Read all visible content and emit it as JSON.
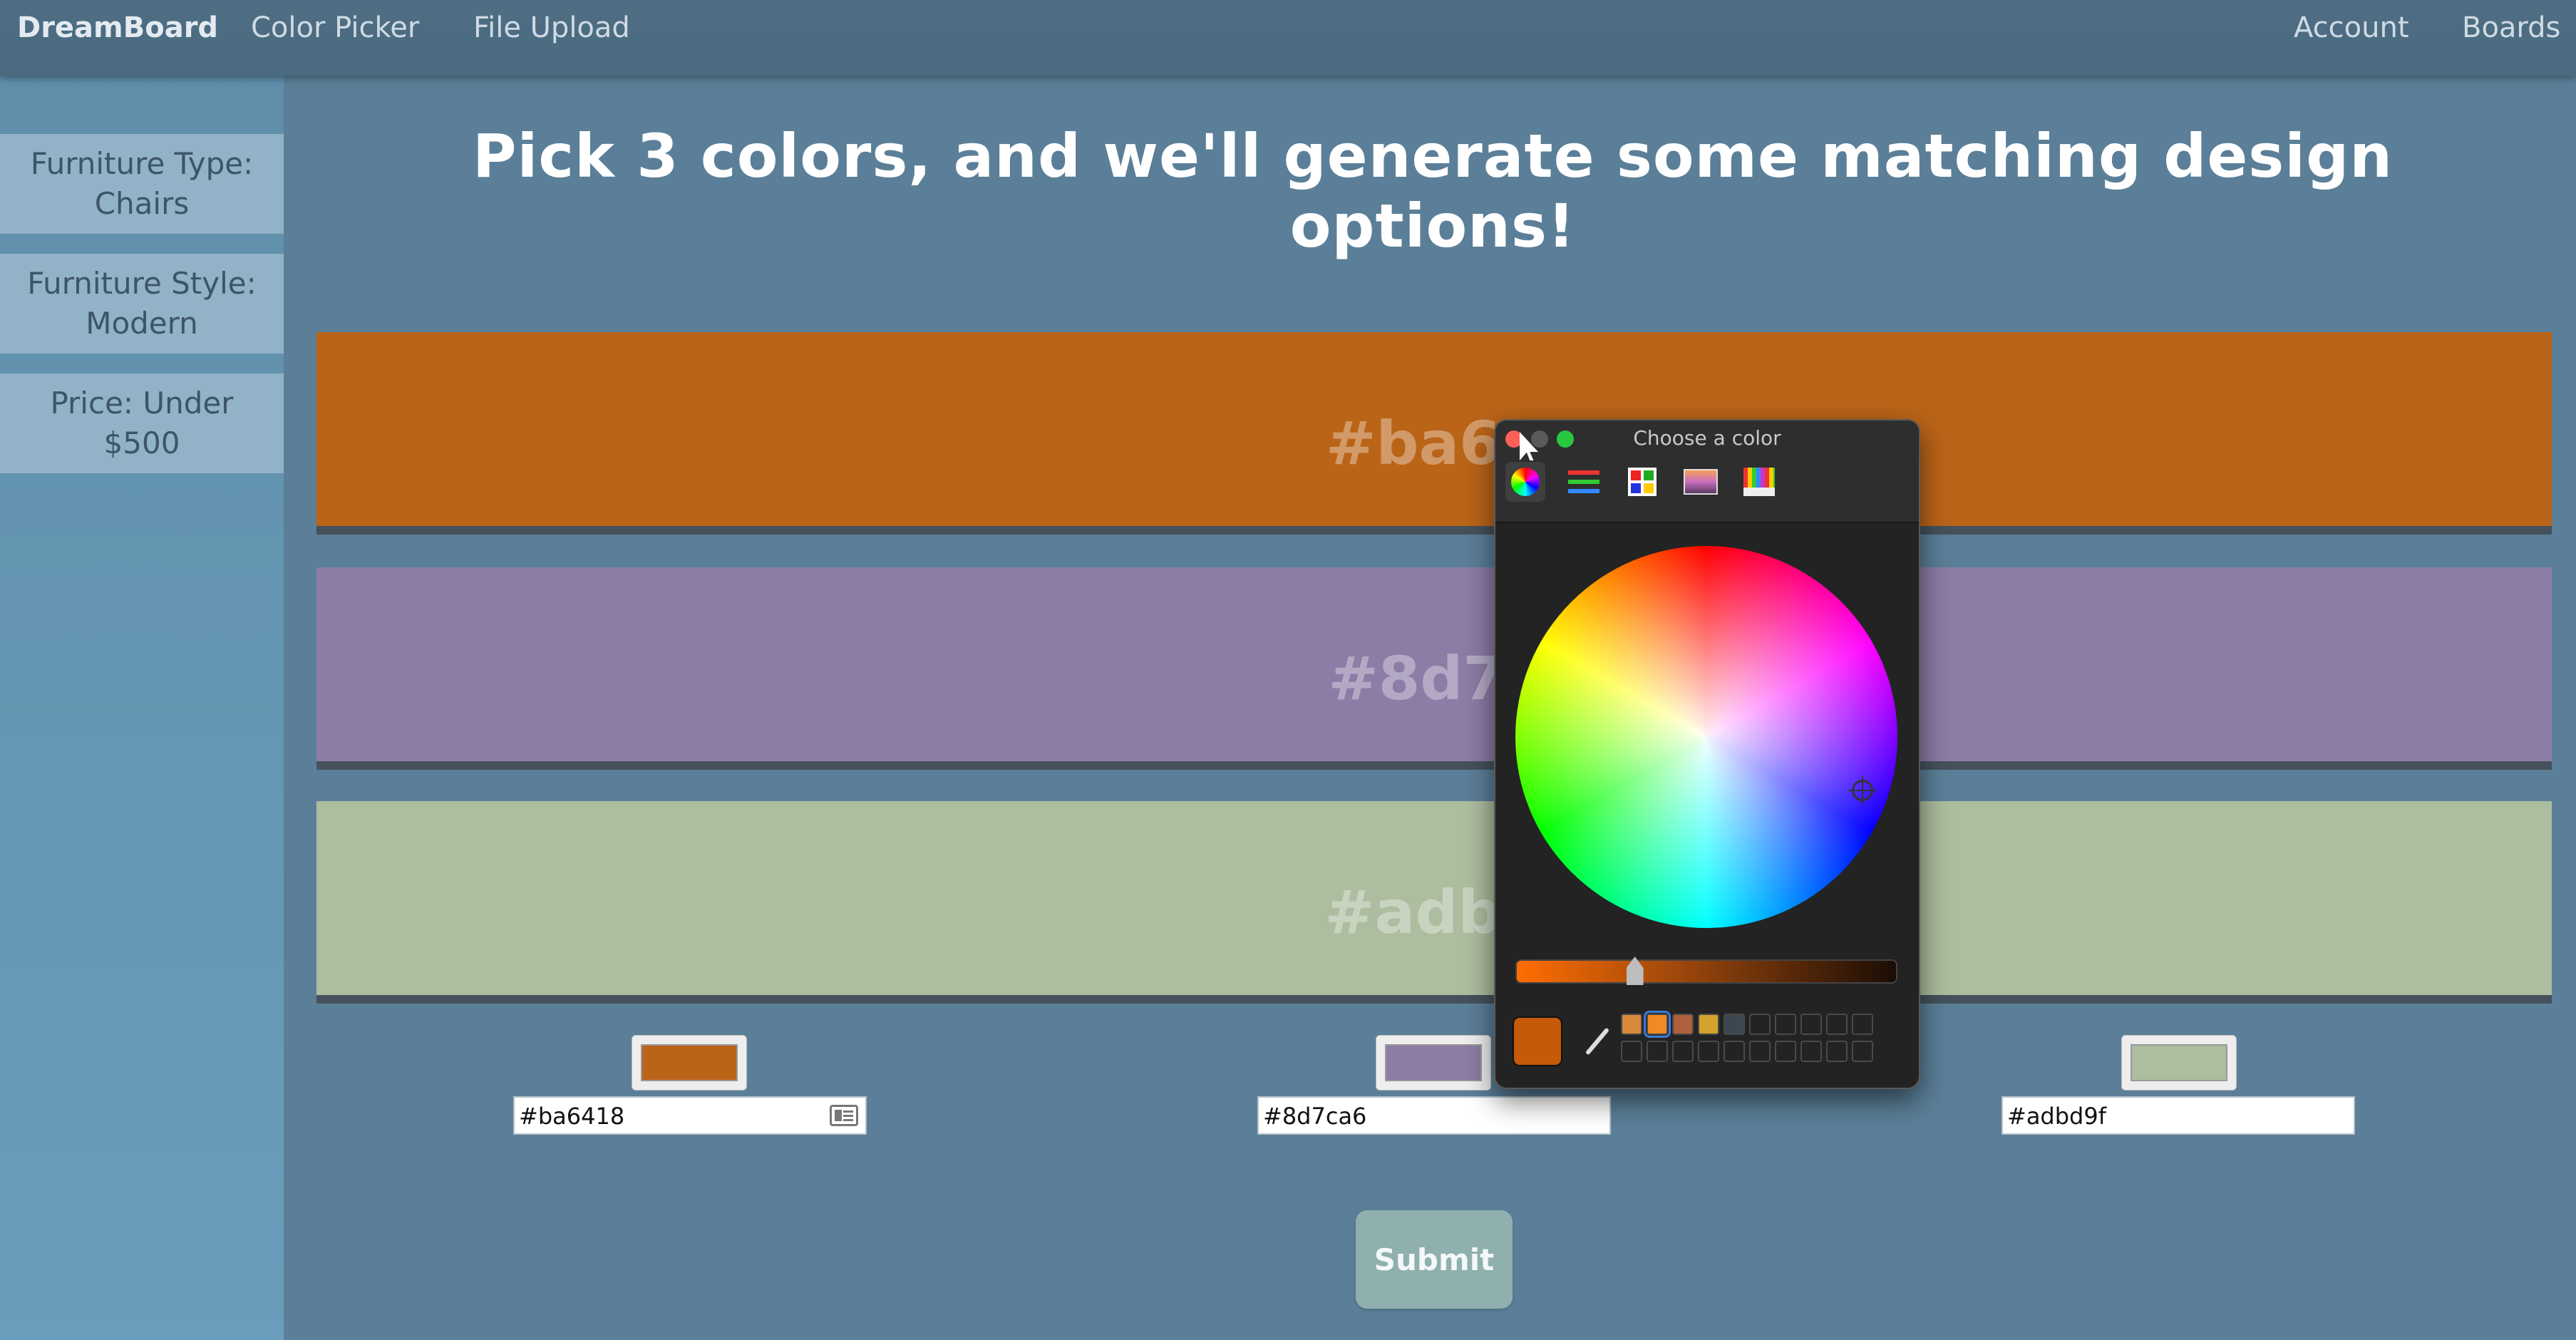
{
  "nav": {
    "brand": "DreamBoard",
    "links": [
      "Color Picker",
      "File Upload"
    ],
    "right_links": [
      "Account",
      "Boards"
    ]
  },
  "sidebar": {
    "filters": [
      {
        "line1": "Furniture Type:",
        "line2": "Chairs"
      },
      {
        "line1": "Furniture Style:",
        "line2": "Modern"
      },
      {
        "line1": "Price: Under",
        "line2": "$500"
      }
    ]
  },
  "headline": "Pick 3 colors, and we'll generate some matching design options!",
  "colors": [
    {
      "hex": "#ba6418",
      "band_label": "#ba64",
      "input_value": "#ba6418"
    },
    {
      "hex": "#8d7ca6",
      "band_label": "#8d7c",
      "input_value": "#8d7ca6"
    },
    {
      "hex": "#adbd9f",
      "band_label": "#adbd",
      "input_value": "#adbd9f"
    }
  ],
  "submit_label": "Submit",
  "color_picker": {
    "title": "Choose a color",
    "tools": [
      "color-wheel-icon",
      "sliders-icon",
      "palettes-icon",
      "image-palettes-icon",
      "pencils-icon"
    ],
    "current_color": "#c55a09",
    "brightness": 0.3,
    "saved_slots": [
      "#d88a3a",
      "#f08a24",
      "#b0603a",
      "#d3a22a",
      "#3d4750"
    ]
  }
}
